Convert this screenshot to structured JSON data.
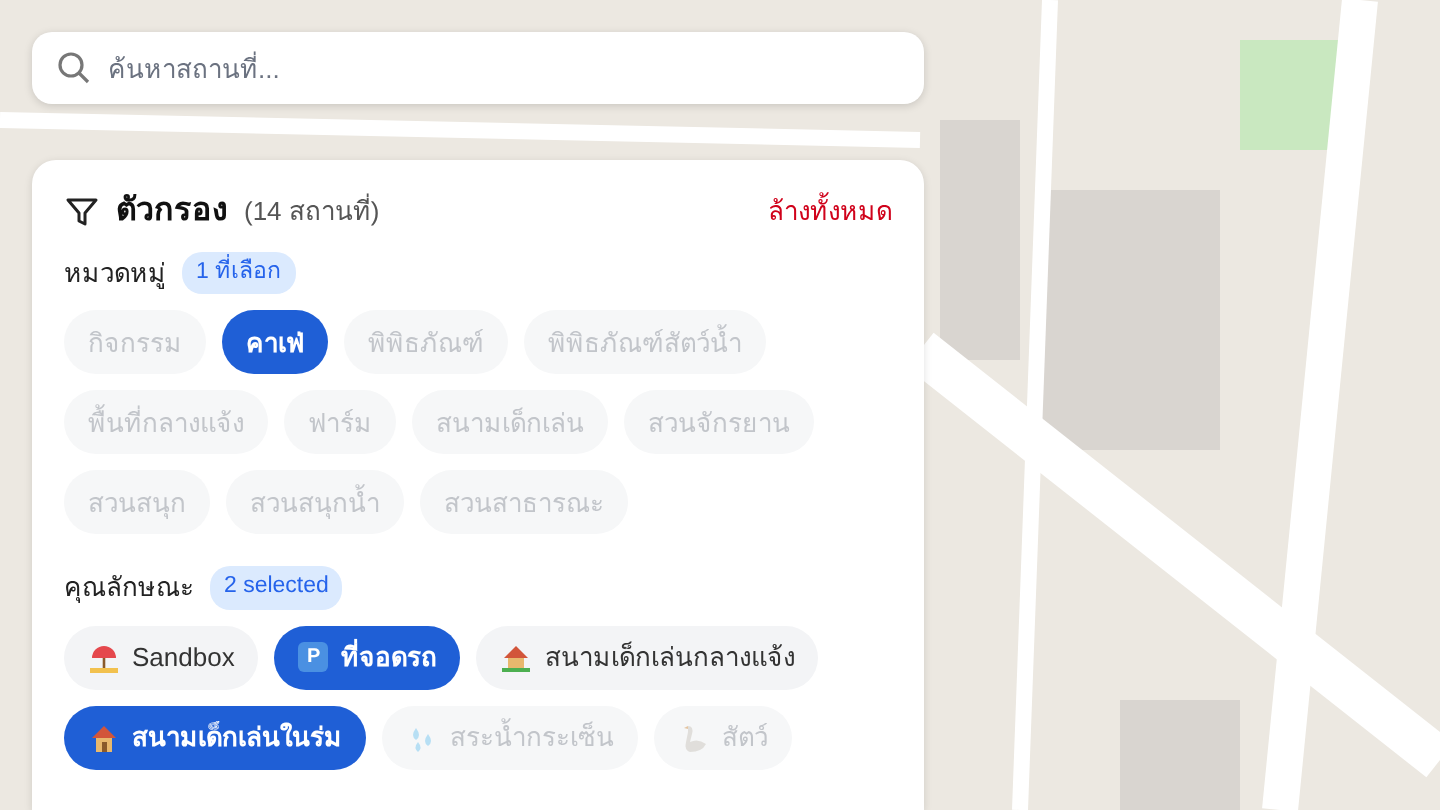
{
  "search": {
    "placeholder": "ค้นหาสถานที่..."
  },
  "filter": {
    "title": "ตัวกรอง",
    "count": "(14 สถานที่)",
    "clear_all": "ล้างทั้งหมด"
  },
  "categories": {
    "label": "หมวดหมู่",
    "badge": "1 ที่เลือก",
    "chips": [
      {
        "label": "กิจกรรม",
        "selected": false,
        "disabled": true
      },
      {
        "label": "คาเฟ่",
        "selected": true,
        "disabled": false
      },
      {
        "label": "พิพิธภัณฑ์",
        "selected": false,
        "disabled": true
      },
      {
        "label": "พิพิธภัณฑ์สัตว์น้ำ",
        "selected": false,
        "disabled": true
      },
      {
        "label": "พื้นที่กลางแจ้ง",
        "selected": false,
        "disabled": true
      },
      {
        "label": "ฟาร์ม",
        "selected": false,
        "disabled": true
      },
      {
        "label": "สนามเด็กเล่น",
        "selected": false,
        "disabled": true
      },
      {
        "label": "สวนจักรยาน",
        "selected": false,
        "disabled": true
      },
      {
        "label": "สวนสนุก",
        "selected": false,
        "disabled": true
      },
      {
        "label": "สวนสนุกน้ำ",
        "selected": false,
        "disabled": true
      },
      {
        "label": "สวนสาธารณะ",
        "selected": false,
        "disabled": true
      }
    ]
  },
  "features": {
    "label": "คุณลักษณะ",
    "badge": "2 selected",
    "chips": [
      {
        "label": "Sandbox",
        "kind": "umbrella",
        "selected": false,
        "disabled": false
      },
      {
        "label": "ที่จอดรถ",
        "kind": "parking",
        "icon_text": "P",
        "selected": true,
        "disabled": false
      },
      {
        "label": "สนามเด็กเล่นกลางแจ้ง",
        "kind": "garden-house",
        "selected": false,
        "disabled": false
      },
      {
        "label": "สนามเด็กเล่นในร่ม",
        "kind": "house",
        "selected": true,
        "disabled": false
      },
      {
        "label": "สระน้ำกระเซ็น",
        "kind": "droplets",
        "selected": false,
        "disabled": true
      },
      {
        "label": "สัตว์",
        "kind": "bird",
        "selected": false,
        "disabled": true
      }
    ]
  }
}
